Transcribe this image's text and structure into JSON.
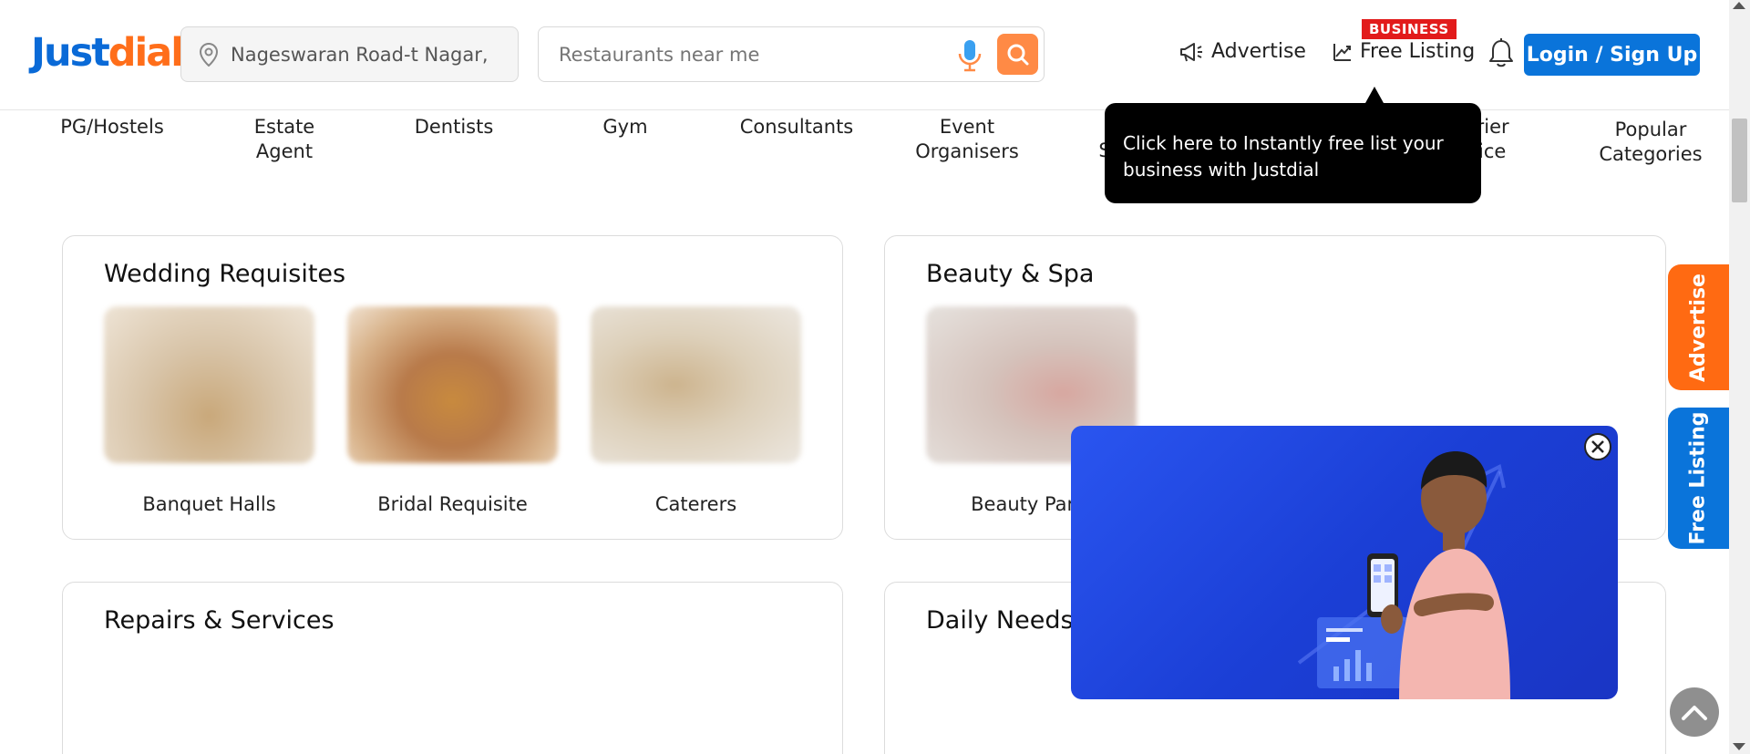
{
  "header": {
    "logo_part1": "Just",
    "logo_part2": "dial",
    "location_value": "Nageswaran Road-t Nagar,",
    "search_placeholder": "Restaurants near me",
    "advertise_label": "Advertise",
    "business_badge": "BUSINESS",
    "free_listing_label": "Free Listing",
    "login_label": "Login / Sign Up"
  },
  "categories": [
    {
      "label": "PG/Hostels"
    },
    {
      "label": "Estate Agent"
    },
    {
      "label": "Dentists"
    },
    {
      "label": "Gym"
    },
    {
      "label": "Consultants"
    },
    {
      "label": "Event Organisers"
    },
    {
      "label": "S"
    },
    {
      "label": "urier vice"
    },
    {
      "label": "Popular Categories"
    }
  ],
  "tooltip": {
    "text": "Click here to Instantly free list your business with Justdial"
  },
  "sections": {
    "wedding": {
      "title": "Wedding Requisites",
      "items": [
        {
          "label": "Banquet Halls"
        },
        {
          "label": "Bridal Requisite"
        },
        {
          "label": "Caterers"
        }
      ]
    },
    "beauty": {
      "title": "Beauty & Spa",
      "items": [
        {
          "label": "Beauty Parlo"
        }
      ]
    },
    "repairs": {
      "title": "Repairs & Services"
    },
    "daily": {
      "title": "Daily Needs"
    }
  },
  "side_tabs": {
    "advertise": "Advertise",
    "free_listing": "Free Listing"
  },
  "colors": {
    "brand_blue": "#0a6ad7",
    "brand_orange": "#ff6e1a",
    "advertise_tab": "#ff6a12",
    "free_listing_tab": "#0a74da",
    "promo_bg": "#1f46e0"
  }
}
